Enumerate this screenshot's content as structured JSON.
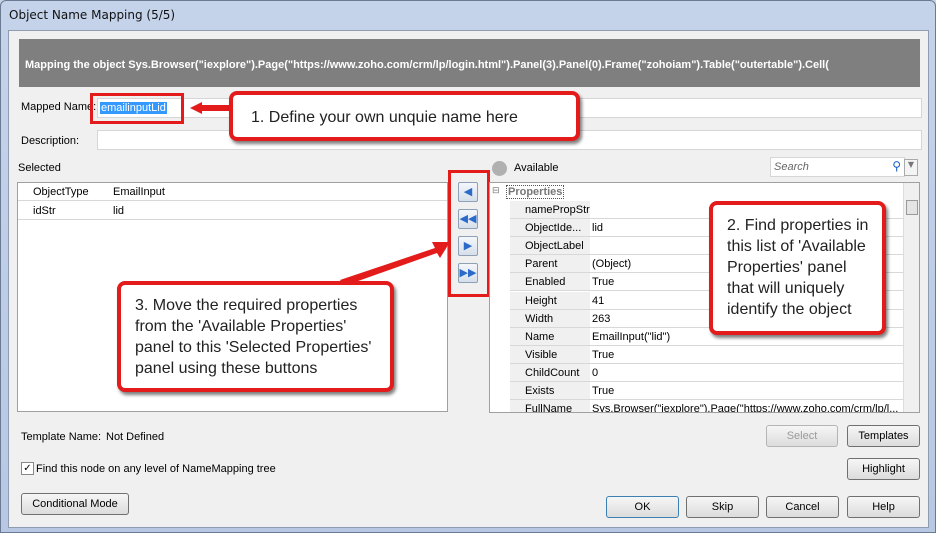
{
  "window": {
    "title": "Object Name Mapping (5/5)"
  },
  "banner": "Mapping the object Sys.Browser(\"iexplore\").Page(\"https://www.zoho.com/crm/lp/login.html\").Panel(3).Panel(0).Frame(\"zohoiam\").Table(\"outertable\").Cell(",
  "mapped_name": {
    "label": "Mapped Name:",
    "value": "emailinputLid"
  },
  "description": {
    "label": "Description:",
    "value": ""
  },
  "selected": {
    "label": "Selected",
    "rows": [
      {
        "name": "ObjectType",
        "value": "EmailInput"
      },
      {
        "name": "idStr",
        "value": "lid"
      }
    ]
  },
  "available": {
    "label": "Available",
    "search_placeholder": "Search",
    "group": "Properties",
    "rows": [
      {
        "name": "namePropStr",
        "value": ""
      },
      {
        "name": "ObjectIde...",
        "value": "lid"
      },
      {
        "name": "ObjectLabel",
        "value": ""
      },
      {
        "name": "Parent",
        "value": "(Object)"
      },
      {
        "name": "Enabled",
        "value": "True"
      },
      {
        "name": "Height",
        "value": "41"
      },
      {
        "name": "Width",
        "value": "263"
      },
      {
        "name": "Name",
        "value": "EmailInput(\"lid\")"
      },
      {
        "name": "Visible",
        "value": "True"
      },
      {
        "name": "ChildCount",
        "value": "0"
      },
      {
        "name": "Exists",
        "value": "True"
      },
      {
        "name": "FullName",
        "value": "Sys.Browser(\"iexplore\").Page(\"https://www.zoho.com/crm/lp/l..."
      }
    ]
  },
  "template": {
    "label": "Template Name:",
    "value": "Not Defined",
    "select": "Select",
    "templates": "Templates"
  },
  "find_node": {
    "label": "Find this node on any level of NameMapping tree",
    "checked": true
  },
  "buttons": {
    "highlight": "Highlight",
    "conditional": "Conditional Mode",
    "ok": "OK",
    "skip": "Skip",
    "cancel": "Cancel",
    "help": "Help"
  },
  "callouts": {
    "c1": "1. Define your own unquie name here",
    "c2": "2. Find properties in this list of 'Available Properties' panel that will uniquely identify the object",
    "c3": "3. Move the required properties from the 'Available Properties' panel to this 'Selected Properties' panel using these buttons"
  },
  "colors": {
    "accent": "#e41b1b",
    "banner": "#7f7f7f"
  }
}
